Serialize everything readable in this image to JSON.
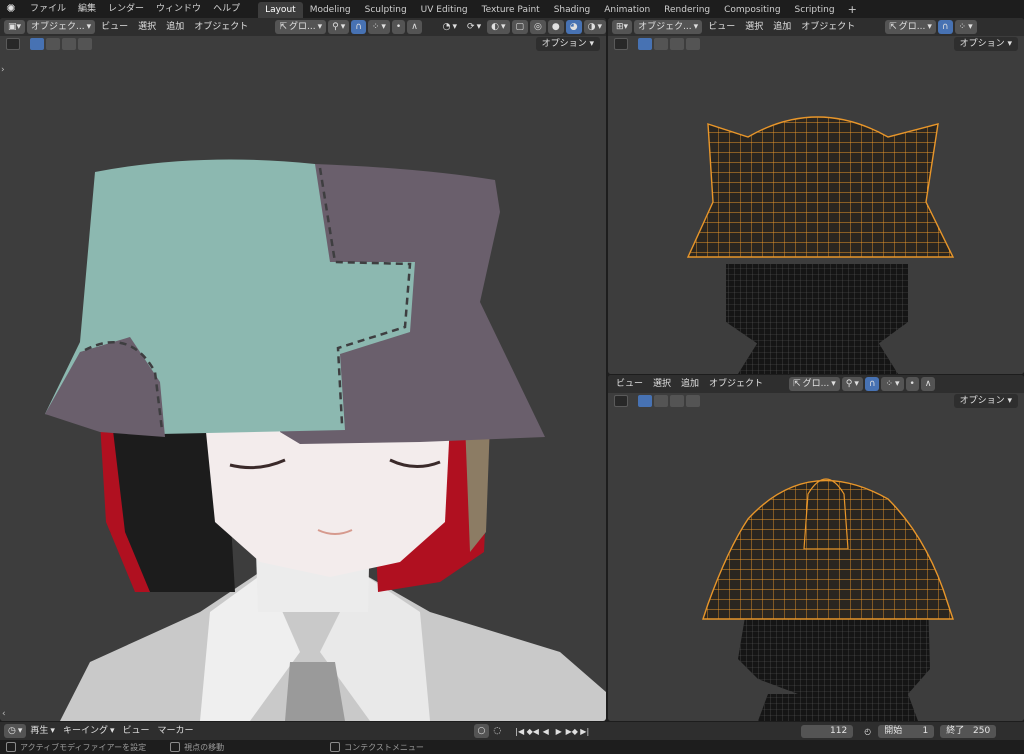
{
  "menu": {
    "logo": "blender-logo",
    "items": [
      "ファイル",
      "編集",
      "レンダー",
      "ウィンドウ",
      "ヘルプ"
    ]
  },
  "workspaces": {
    "tabs": [
      "Layout",
      "Modeling",
      "Sculpting",
      "UV Editing",
      "Texture Paint",
      "Shading",
      "Animation",
      "Rendering",
      "Compositing",
      "Scripting"
    ],
    "active": "Layout",
    "add": "+"
  },
  "viewport_main": {
    "mode": "オブジェク...",
    "menus": [
      "ビュー",
      "選択",
      "追加",
      "オブジェクト"
    ],
    "transform": "グロ...",
    "options": "オプション"
  },
  "viewport_top_right": {
    "mode": "オブジェク...",
    "menus": [
      "ビュー",
      "選択",
      "追加",
      "オブジェクト"
    ],
    "transform": "グロ...",
    "options": "オプション"
  },
  "viewport_bottom_right": {
    "menus": [
      "ビュー",
      "選択",
      "追加",
      "オブジェクト"
    ],
    "transform": "グロ...",
    "options": "オプション"
  },
  "timeline": {
    "play": "再生",
    "keying": "キーイング",
    "view": "ビュー",
    "marker": "マーカー",
    "current_frame": "112",
    "start_label": "開始",
    "start": "1",
    "end_label": "終了",
    "end": "250"
  },
  "status": {
    "left": "アクティブモディファイアーを設定",
    "middle": "視点の移動",
    "right": "コンテクストメニュー"
  },
  "colors": {
    "accent": "#4772b3",
    "wire_selected": "#e8962a",
    "hat_teal": "#8cb8b0",
    "hat_purple": "#6a5f6c",
    "hair_red": "#b01020"
  }
}
